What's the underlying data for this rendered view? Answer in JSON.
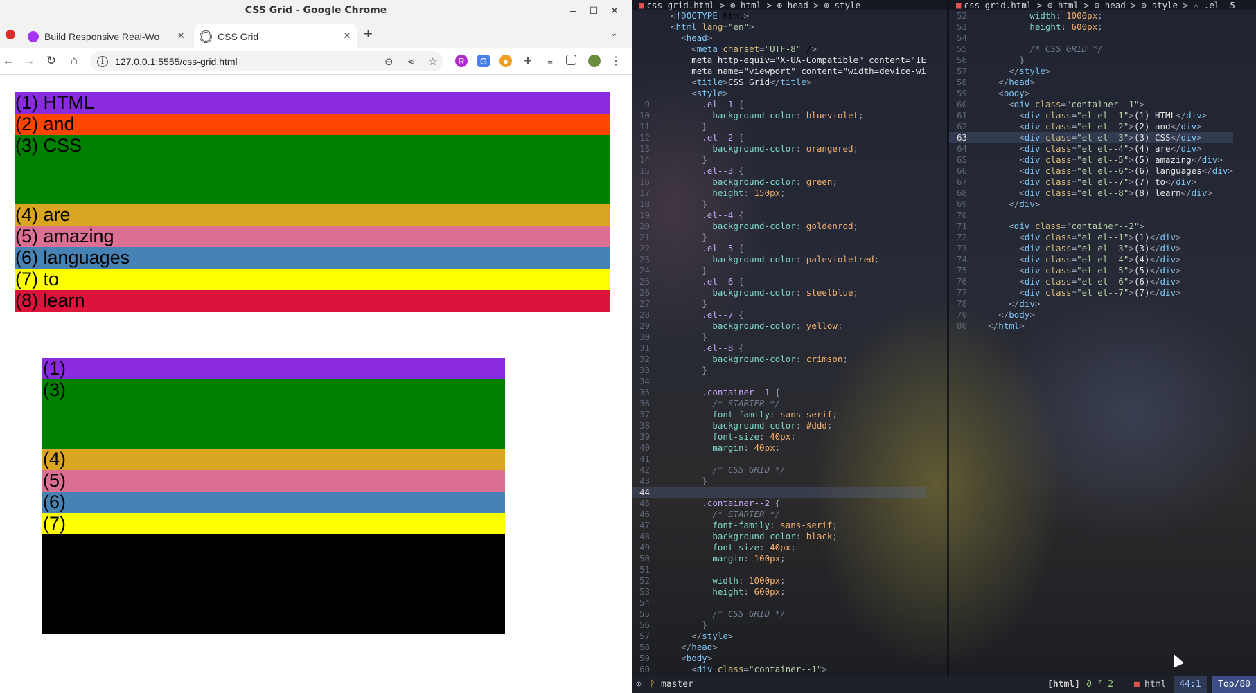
{
  "window": {
    "title": "CSS Grid - Google Chrome",
    "minimize": "–",
    "maximize": "☐",
    "close": "✕"
  },
  "tabs": [
    {
      "label": "Build Responsive Real-Wo",
      "icon": "udemy-icon",
      "close": "✕"
    },
    {
      "label": "CSS Grid",
      "icon": "broadcast-icon",
      "close": "✕"
    }
  ],
  "newtab": "+",
  "tabmenu": "⌄",
  "nav": {
    "back": "←",
    "forward": "→",
    "reload": "↻",
    "home": "⌂",
    "url": "127.0.0.1:5555/css-grid.html",
    "info": "i"
  },
  "page": {
    "container1": [
      {
        "text": "(1) HTML",
        "color": "#8a2be2"
      },
      {
        "text": "(2) and",
        "color": "#ff4500"
      },
      {
        "text": "(3) CSS",
        "color": "#008000"
      },
      {
        "text": "(4) are",
        "color": "#daa520"
      },
      {
        "text": "(5) amazing",
        "color": "#db7093"
      },
      {
        "text": "(6) languages",
        "color": "#4682b4"
      },
      {
        "text": "(7) to",
        "color": "#ffff00"
      },
      {
        "text": "(8) learn",
        "color": "#dc143c"
      }
    ],
    "container2": [
      {
        "text": "(1)",
        "color": "#8a2be2"
      },
      {
        "text": "(3)",
        "color": "#008000"
      },
      {
        "text": "(4)",
        "color": "#daa520"
      },
      {
        "text": "(5)",
        "color": "#db7093"
      },
      {
        "text": "(6)",
        "color": "#4682b4"
      },
      {
        "text": "(7)",
        "color": "#ffff00"
      }
    ]
  },
  "editor": {
    "left_crumb": "css-grid.html > ⊕ html > ⊕ head > ⊕ style",
    "right_crumb": "css-grid.html > ⊕ html > ⊕ head > ⊕ style > ⚠ .el--5",
    "status": {
      "mode": "⊙",
      "branch_icon": "ᚹ",
      "branch": "master",
      "filetype": "[html]",
      "diag": "ϑ ⁷ 2",
      "lang": "html",
      "pos": "44:1",
      "scroll": "Top/80"
    }
  }
}
